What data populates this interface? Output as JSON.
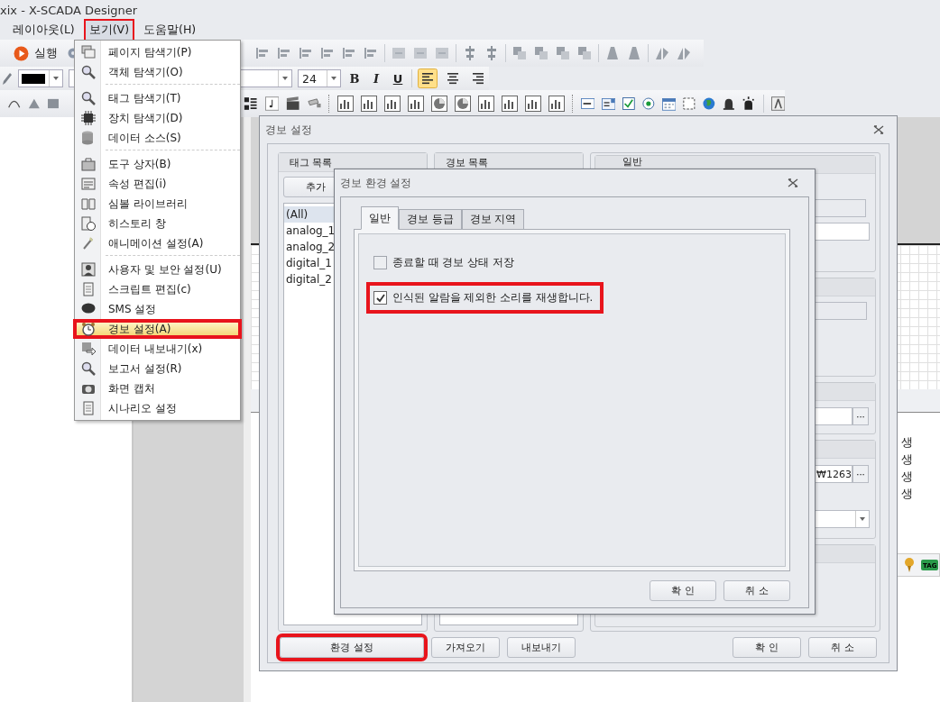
{
  "window": {
    "title": "xix - X-SCADA Designer"
  },
  "menu_bar": [
    {
      "label": "레이아웃(L)",
      "selected": false,
      "highlighted": false
    },
    {
      "label": "보기(V)",
      "selected": true,
      "highlighted": true
    },
    {
      "label": "도움말(H)",
      "selected": false,
      "highlighted": false
    }
  ],
  "toolbar": {
    "run_label": "실행",
    "font_size": "24",
    "format_buttons": [
      "B",
      "I",
      "U"
    ],
    "alignments": [
      {
        "kind": "left",
        "selected": true
      },
      {
        "kind": "center",
        "selected": false
      },
      {
        "kind": "right",
        "selected": false
      }
    ]
  },
  "view_menu": [
    {
      "kind": "item",
      "label": "페이지 탐색기(P)",
      "selected": false,
      "highlighted": false
    },
    {
      "kind": "item",
      "label": "객체 탐색기(O)",
      "selected": false,
      "highlighted": false
    },
    {
      "kind": "separator"
    },
    {
      "kind": "item",
      "label": "태그 탐색기(T)",
      "selected": false,
      "highlighted": false
    },
    {
      "kind": "item",
      "label": "장치 탐색기(D)",
      "selected": false,
      "highlighted": false
    },
    {
      "kind": "item",
      "label": "데이터 소스(S)",
      "selected": false,
      "highlighted": false
    },
    {
      "kind": "separator"
    },
    {
      "kind": "item",
      "label": "도구 상자(B)",
      "selected": false,
      "highlighted": false
    },
    {
      "kind": "item",
      "label": "속성 편집(i)",
      "selected": false,
      "highlighted": false
    },
    {
      "kind": "item",
      "label": "심볼 라이브러리",
      "selected": false,
      "highlighted": false
    },
    {
      "kind": "item",
      "label": "히스토리 창",
      "selected": false,
      "highlighted": false
    },
    {
      "kind": "item",
      "label": "애니메이션 설정(A)",
      "selected": false,
      "highlighted": false
    },
    {
      "kind": "separator"
    },
    {
      "kind": "item",
      "label": "사용자 및 보안 설정(U)",
      "selected": false,
      "highlighted": false
    },
    {
      "kind": "item",
      "label": "스크립트 편집(c)",
      "selected": false,
      "highlighted": false
    },
    {
      "kind": "item",
      "label": "SMS 설정",
      "selected": false,
      "highlighted": false
    },
    {
      "kind": "item",
      "label": "경보 설정(A)",
      "selected": true,
      "highlighted": true
    },
    {
      "kind": "item",
      "label": "데이터 내보내기(x)",
      "selected": false,
      "highlighted": false
    },
    {
      "kind": "item",
      "label": "보고서 설정(R)",
      "selected": false,
      "highlighted": false
    },
    {
      "kind": "item",
      "label": "화면 캡처",
      "selected": false,
      "highlighted": false
    },
    {
      "kind": "item",
      "label": "시나리오 설정",
      "selected": false,
      "highlighted": false
    }
  ],
  "alarm_dialog": {
    "title": "경보 설정",
    "tag_list": {
      "heading": "태그 목록",
      "add_button": "추가",
      "items": [
        {
          "label": "(All)",
          "selected": true
        },
        {
          "label": "analog_1",
          "selected": false
        },
        {
          "label": "analog_2",
          "selected": false
        },
        {
          "label": "digital_1",
          "selected": false
        },
        {
          "label": "digital_2",
          "selected": false
        }
      ]
    },
    "alarm_list": {
      "heading": "경보 목록"
    },
    "general": {
      "heading": "일반",
      "path_value": "₩1263",
      "browse_buttons": [
        "···",
        "···"
      ]
    },
    "buttons": [
      {
        "label": "환경 설정",
        "highlighted": true
      },
      {
        "label": "가져오기",
        "highlighted": false
      },
      {
        "label": "내보내기",
        "highlighted": false
      },
      {
        "label": "확 인",
        "highlighted": false
      },
      {
        "label": "취 소",
        "highlighted": false
      }
    ]
  },
  "settings_dialog": {
    "title": "경보 환경 설정",
    "tabs": [
      {
        "label": "일반",
        "selected": true
      },
      {
        "label": "경보 등급",
        "selected": false
      },
      {
        "label": "경보 지역",
        "selected": false
      }
    ],
    "options": [
      {
        "label": "종료할 때 경보 상태 저장",
        "checked": false,
        "highlighted": false
      },
      {
        "label": "인식된 알람을 제외한 소리를 재생합니다.",
        "checked": true,
        "highlighted": true
      }
    ],
    "buttons": [
      "확 인",
      "취 소"
    ]
  },
  "canvas": {
    "texts": [
      "생",
      "생",
      "생",
      "생"
    ],
    "tag_label": "TAG"
  }
}
